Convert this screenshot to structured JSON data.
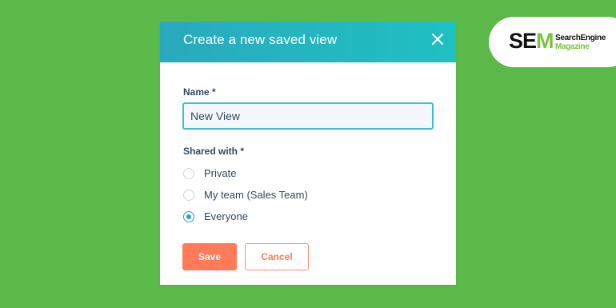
{
  "colors": {
    "background": "#5BB94A",
    "header_gradient_start": "#2AA9BE",
    "header_gradient_end": "#1FC0C2",
    "input_border": "#39C0D3",
    "radio_checked": "#2EA3B7",
    "save_button": "#FF7A59",
    "text": "#33475B",
    "logo_green": "#7DC242"
  },
  "modal": {
    "title": "Create a new saved view",
    "close_icon": "close-icon"
  },
  "form": {
    "name_label": "Name *",
    "name_value": "New View",
    "shared_label": "Shared with *",
    "shared_options": [
      {
        "label": "Private",
        "checked": false
      },
      {
        "label": "My team (Sales Team)",
        "checked": false
      },
      {
        "label": "Everyone",
        "checked": true
      }
    ],
    "save_label": "Save",
    "cancel_label": "Cancel"
  },
  "logo": {
    "mark_s": "S",
    "mark_e": "E",
    "mark_m": "M",
    "line1": "SearchEngine",
    "line2": "Magazine"
  }
}
